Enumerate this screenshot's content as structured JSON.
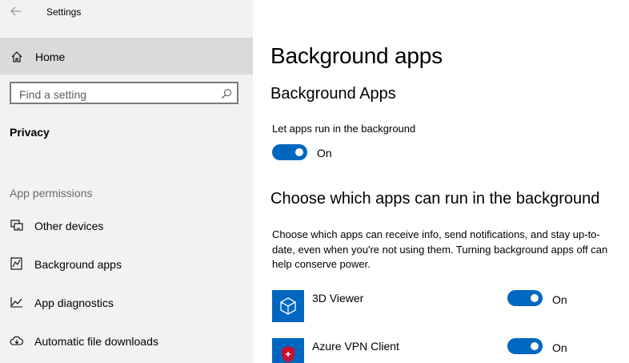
{
  "window": {
    "title": "Settings"
  },
  "sidebar": {
    "home_label": "Home",
    "search_placeholder": "Find a setting",
    "section": "Privacy",
    "group_label": "App permissions",
    "items": [
      {
        "label": "Other devices",
        "icon": "other-devices-icon"
      },
      {
        "label": "Background apps",
        "icon": "background-apps-icon"
      },
      {
        "label": "App diagnostics",
        "icon": "app-diagnostics-icon"
      },
      {
        "label": "Automatic file downloads",
        "icon": "cloud-download-icon"
      }
    ]
  },
  "main": {
    "title": "Background apps",
    "section1_heading": "Background Apps",
    "toggle_description": "Let apps run in the background",
    "master_toggle": {
      "state": "On",
      "checked": true
    },
    "section2_heading": "Choose which apps can run in the background",
    "paragraph": "Choose which apps can receive info, send notifications, and stay up-to-date, even when you're not using them. Turning background apps off can help conserve power.",
    "apps": [
      {
        "name": "3D Viewer",
        "icon": "cube-icon",
        "state": "On",
        "checked": true
      },
      {
        "name": "Azure VPN Client",
        "icon": "shield-icon",
        "state": "On",
        "checked": true
      }
    ]
  },
  "colors": {
    "accent": "#0067c0",
    "sidebar_bg": "#f2f2f2",
    "selected_bg": "#dadada"
  }
}
